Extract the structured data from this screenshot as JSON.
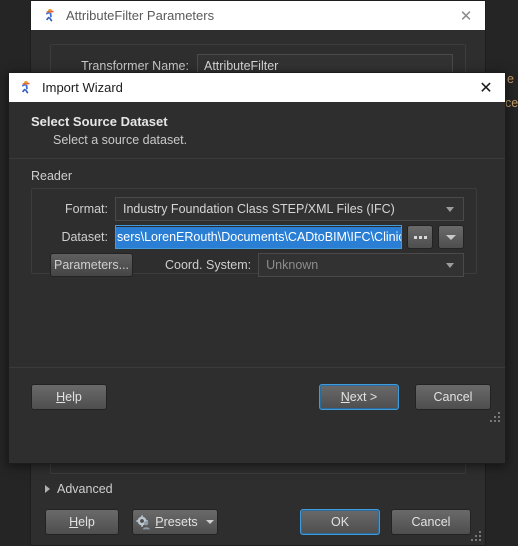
{
  "parent_dialog": {
    "title": "AttributeFilter Parameters",
    "icon": "fme-runner-icon",
    "close_icon": "close-icon",
    "transformer_name_label": "Transformer Name:",
    "transformer_name_value": "AttributeFilter",
    "advanced_label": "Advanced",
    "advanced_icon": "chevron-right-icon",
    "buttons": {
      "help": "Help",
      "presets": "Presets",
      "presets_icon": "gear-person-icon",
      "presets_caret_icon": "chevron-down-icon",
      "ok": "OK",
      "cancel": "Cancel"
    }
  },
  "wizard": {
    "title": "Import Wizard",
    "icon": "fme-runner-icon",
    "close_icon": "close-icon",
    "heading": "Select Source Dataset",
    "subheading": "Select a source dataset.",
    "reader_group_label": "Reader",
    "fields": {
      "format_label": "Format:",
      "format_value": "Industry Foundation Class STEP/XML Files (IFC)",
      "format_caret_icon": "chevron-down-icon",
      "dataset_label": "Dataset:",
      "dataset_value": "sers\\LorenERouth\\Documents\\CADtoBIM\\IFC\\Clinic_Architectural.ifc",
      "dataset_browse_label": "...",
      "dataset_browse_icon": "ellipsis-icon",
      "dataset_history_icon": "chevron-down-icon",
      "parameters_button": "Parameters...",
      "coord_system_label": "Coord. System:",
      "coord_system_value": "Unknown",
      "coord_system_caret_icon": "chevron-down-icon"
    },
    "buttons": {
      "help": "Help",
      "next": "Next >",
      "cancel": "Cancel"
    }
  },
  "background_peek": {
    "fragment_1": "e",
    "fragment_2": "ce"
  },
  "colors": {
    "accent_blue": "#3f9bdc",
    "selection_blue": "#2a7fd4",
    "dialog_bg": "#2e2e2e",
    "titlebar_bg": "#ffffff"
  }
}
